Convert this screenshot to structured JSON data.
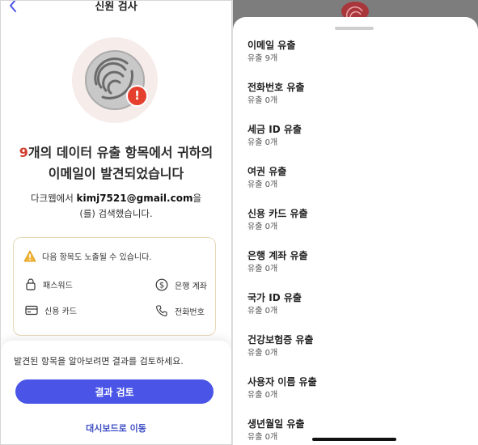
{
  "left": {
    "title": "신원 검사",
    "headline": {
      "count": "9",
      "line1": "개의 데이터 유출 항목에서 귀하의",
      "line2": "이메일이 발견되었습니다"
    },
    "sub": {
      "prefix": "다크웹에서 ",
      "email": "kimj7521@gmail.com",
      "suffix": "을",
      "line2": "(를) 검색했습니다."
    },
    "card": {
      "warning": "다음 항목도 노출될 수 있습니다.",
      "items": [
        "패스워드",
        "은행 계좌",
        "신용 카드",
        "전화번호"
      ]
    },
    "sheet": {
      "text": "발견된 항목을 알아보려면 결과를 검토하세요.",
      "primary_button": "결과 검토",
      "dashboard_link": "대시보드로 이동"
    }
  },
  "right": {
    "leaks": [
      {
        "title": "이메일 유출",
        "count": "유출 9개"
      },
      {
        "title": "전화번호 유출",
        "count": "유출 0개"
      },
      {
        "title": "세금 ID 유출",
        "count": "유출 0개"
      },
      {
        "title": "여권 유출",
        "count": "유출 0개"
      },
      {
        "title": "신용 카드 유출",
        "count": "유출 0개"
      },
      {
        "title": "은행 계좌 유출",
        "count": "유출 0개"
      },
      {
        "title": "국가 ID 유출",
        "count": "유출 0개"
      },
      {
        "title": "건강보험증 유출",
        "count": "유출 0개"
      },
      {
        "title": "사용자 이름 유출",
        "count": "유출 0개"
      },
      {
        "title": "생년월일 유출",
        "count": "유출 0개"
      }
    ]
  },
  "colors": {
    "accent_red": "#d1402e",
    "primary_button": "#4a55e8",
    "link": "#3f4fc4",
    "card_border": "#e6d8b6"
  },
  "icons": [
    "back-icon",
    "fingerprint-icon",
    "alert-icon",
    "warning-icon",
    "lock-icon",
    "dollar-icon",
    "credit-card-icon",
    "phone-icon"
  ]
}
